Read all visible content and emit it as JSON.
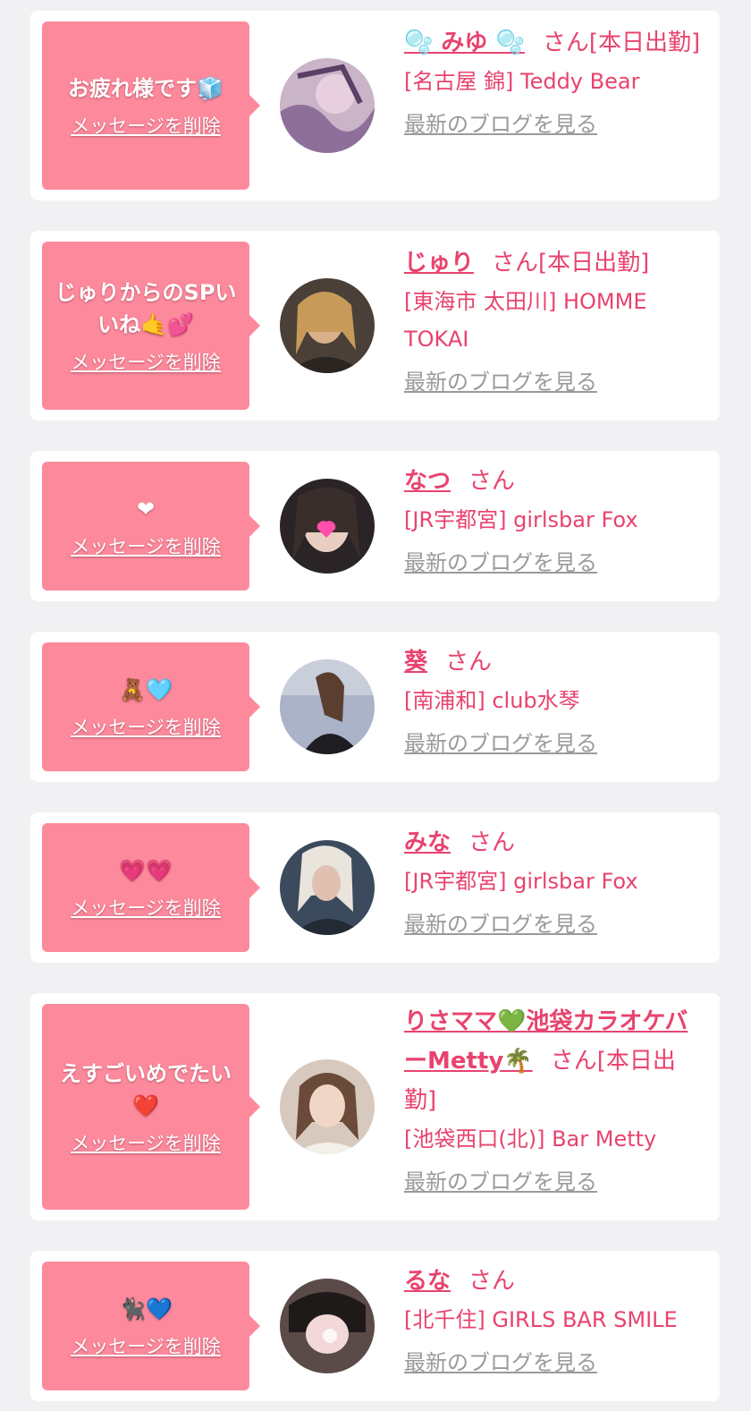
{
  "colors": {
    "background": "#f1f1f3",
    "bubble": "#fd8a9c",
    "accent": "#e8436e",
    "link_gray": "#9a9a9a"
  },
  "labels": {
    "delete": "メッセージを削除",
    "blog": "最新のブログを見る"
  },
  "items": [
    {
      "message": "お疲れ様です🧊",
      "name": "🫧 みゆ 🫧",
      "honorific": "さん[本日出勤]",
      "shop": "[名古屋 錦] Teddy Bear"
    },
    {
      "message": "じゅりからのSPいいね🤙💕",
      "name": "じゅり",
      "honorific": "さん[本日出勤]",
      "shop": "[東海市 太田川] HOMME TOKAI"
    },
    {
      "message": "❤",
      "name": "なつ",
      "honorific": "さん",
      "shop": "[JR宇都宮] girlsbar Fox"
    },
    {
      "message": "🧸🩵",
      "name": "葵",
      "honorific": "さん",
      "shop": "[南浦和] club水琴"
    },
    {
      "message": "💗💗",
      "name": "みな",
      "honorific": "さん",
      "shop": "[JR宇都宮] girlsbar Fox"
    },
    {
      "message": "えすごいめでたい❤️",
      "name": "りさママ💚池袋カラオケバーMetty🌴",
      "honorific": "さん[本日出勤]",
      "shop": "[池袋西口(北)] Bar Metty"
    },
    {
      "message": "🐈‍⬛💙",
      "name": "るな",
      "honorific": "さん",
      "shop": "[北千住] GIRLS BAR SMILE"
    }
  ]
}
